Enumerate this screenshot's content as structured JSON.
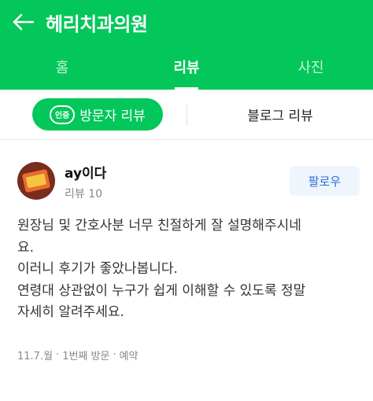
{
  "header": {
    "title": "헤리치과의원",
    "back_icon": "arrow-left-icon"
  },
  "tabs": [
    {
      "label": "홈",
      "active": false
    },
    {
      "label": "리뷰",
      "active": true
    },
    {
      "label": "사진",
      "active": false
    }
  ],
  "subtabs": {
    "visitor_badge": "인증",
    "visitor_label": "방문자 리뷰",
    "blog_label": "블로그 리뷰"
  },
  "review": {
    "username": "ay이다",
    "review_count": "리뷰 10",
    "follow_label": "팔로우",
    "lines": [
      "원장님 및 간호사분 너무 친절하게 잘 설명해주시네",
      "요.",
      "이러니 후기가 좋았나봅니다.",
      "연령대 상관없이 누구가 쉽게 이해할 수 있도록 정말",
      "자세히 알려주세요."
    ],
    "meta": {
      "date": "11.7.월",
      "visit": "1번째 방문",
      "type": "예약",
      "separator": "·"
    }
  },
  "colors": {
    "brand_green": "#03c75a",
    "follow_bg": "#eef5fd",
    "follow_text": "#2f6fd8"
  }
}
